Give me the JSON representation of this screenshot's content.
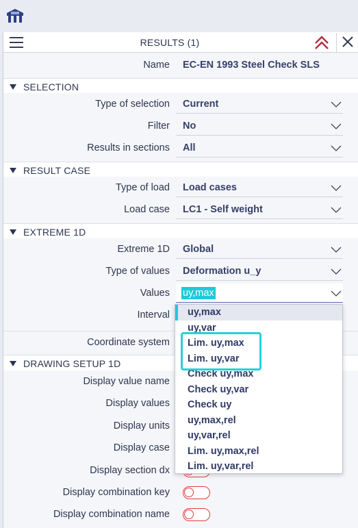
{
  "header": {
    "title": "RESULTS (1)"
  },
  "name_row": {
    "label": "Name",
    "value": "EC-EN 1993 Steel Check SLS"
  },
  "sections": {
    "selection": "SELECTION",
    "result_case": "RESULT CASE",
    "extreme": "EXTREME 1D",
    "drawing": "DRAWING SETUP 1D"
  },
  "selection": [
    {
      "label": "Type of selection",
      "value": "Current"
    },
    {
      "label": "Filter",
      "value": "No"
    },
    {
      "label": "Results in sections",
      "value": "All"
    }
  ],
  "result_case": [
    {
      "label": "Type of load",
      "value": "Load cases"
    },
    {
      "label": "Load case",
      "value": "LC1 - Self weight"
    }
  ],
  "extreme": [
    {
      "label": "Extreme 1D",
      "value": "Global"
    },
    {
      "label": "Type of values",
      "value": "Deformation u_y"
    },
    {
      "label": "Values",
      "value": "uy,max"
    },
    {
      "label": "Interval",
      "value": ""
    }
  ],
  "coordinate": {
    "label": "Coordinate system"
  },
  "drawing": [
    {
      "label": "Display value name"
    },
    {
      "label": "Display values"
    },
    {
      "label": "Display units"
    },
    {
      "label": "Display case"
    },
    {
      "label": "Display section dx"
    },
    {
      "label": "Display combination key"
    },
    {
      "label": "Display combination name"
    }
  ],
  "dropdown": {
    "selected_index": 0,
    "options": [
      "uy,max",
      "uy,var",
      "Lim. uy,max",
      "Lim. uy,var",
      "Check uy,max",
      "Check uy,var",
      "Check uy",
      "uy,max,rel",
      "uy,var,rel",
      "Lim. uy,max,rel",
      "Lim. uy,var,rel"
    ]
  },
  "colors": {
    "accent": "#21c9d6",
    "toggle_off": "#e03a3a",
    "pin": "#b03040"
  },
  "icons": {
    "app": "app-logo-icon",
    "menu": "hamburger-menu-icon",
    "pin": "pin-up-icon",
    "close": "close-icon",
    "chevron": "chevron-down-icon",
    "collapse": "triangle-down-icon"
  }
}
